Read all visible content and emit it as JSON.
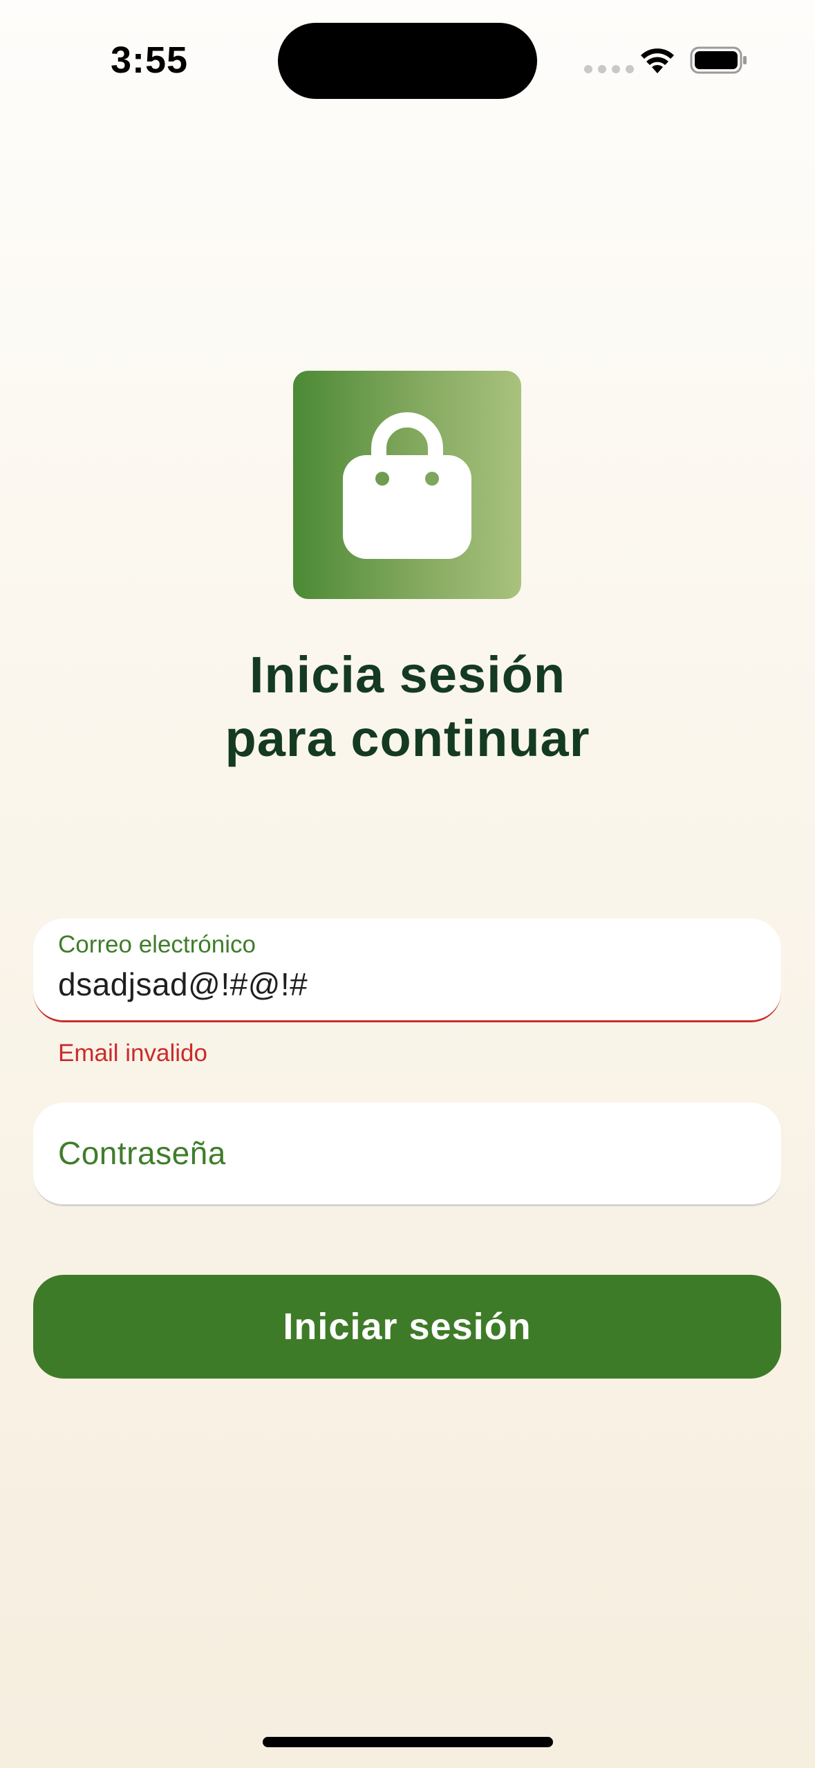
{
  "status_bar": {
    "time": "3:55"
  },
  "logo": {
    "icon": "shopping-bag-icon",
    "colors": [
      "#4c8a35",
      "#a9c27d"
    ]
  },
  "heading": {
    "line1": "Inicia sesión",
    "line2": "para continuar"
  },
  "form": {
    "email": {
      "label": "Correo electrónico",
      "value": "dsadjsad@!#@!#",
      "error": "Email invalido"
    },
    "password": {
      "placeholder": "Contraseña"
    },
    "submit_label": "Iniciar sesión"
  },
  "colors": {
    "accent": "#3e7b28",
    "title": "#153a22",
    "error": "#cc2a2a"
  }
}
